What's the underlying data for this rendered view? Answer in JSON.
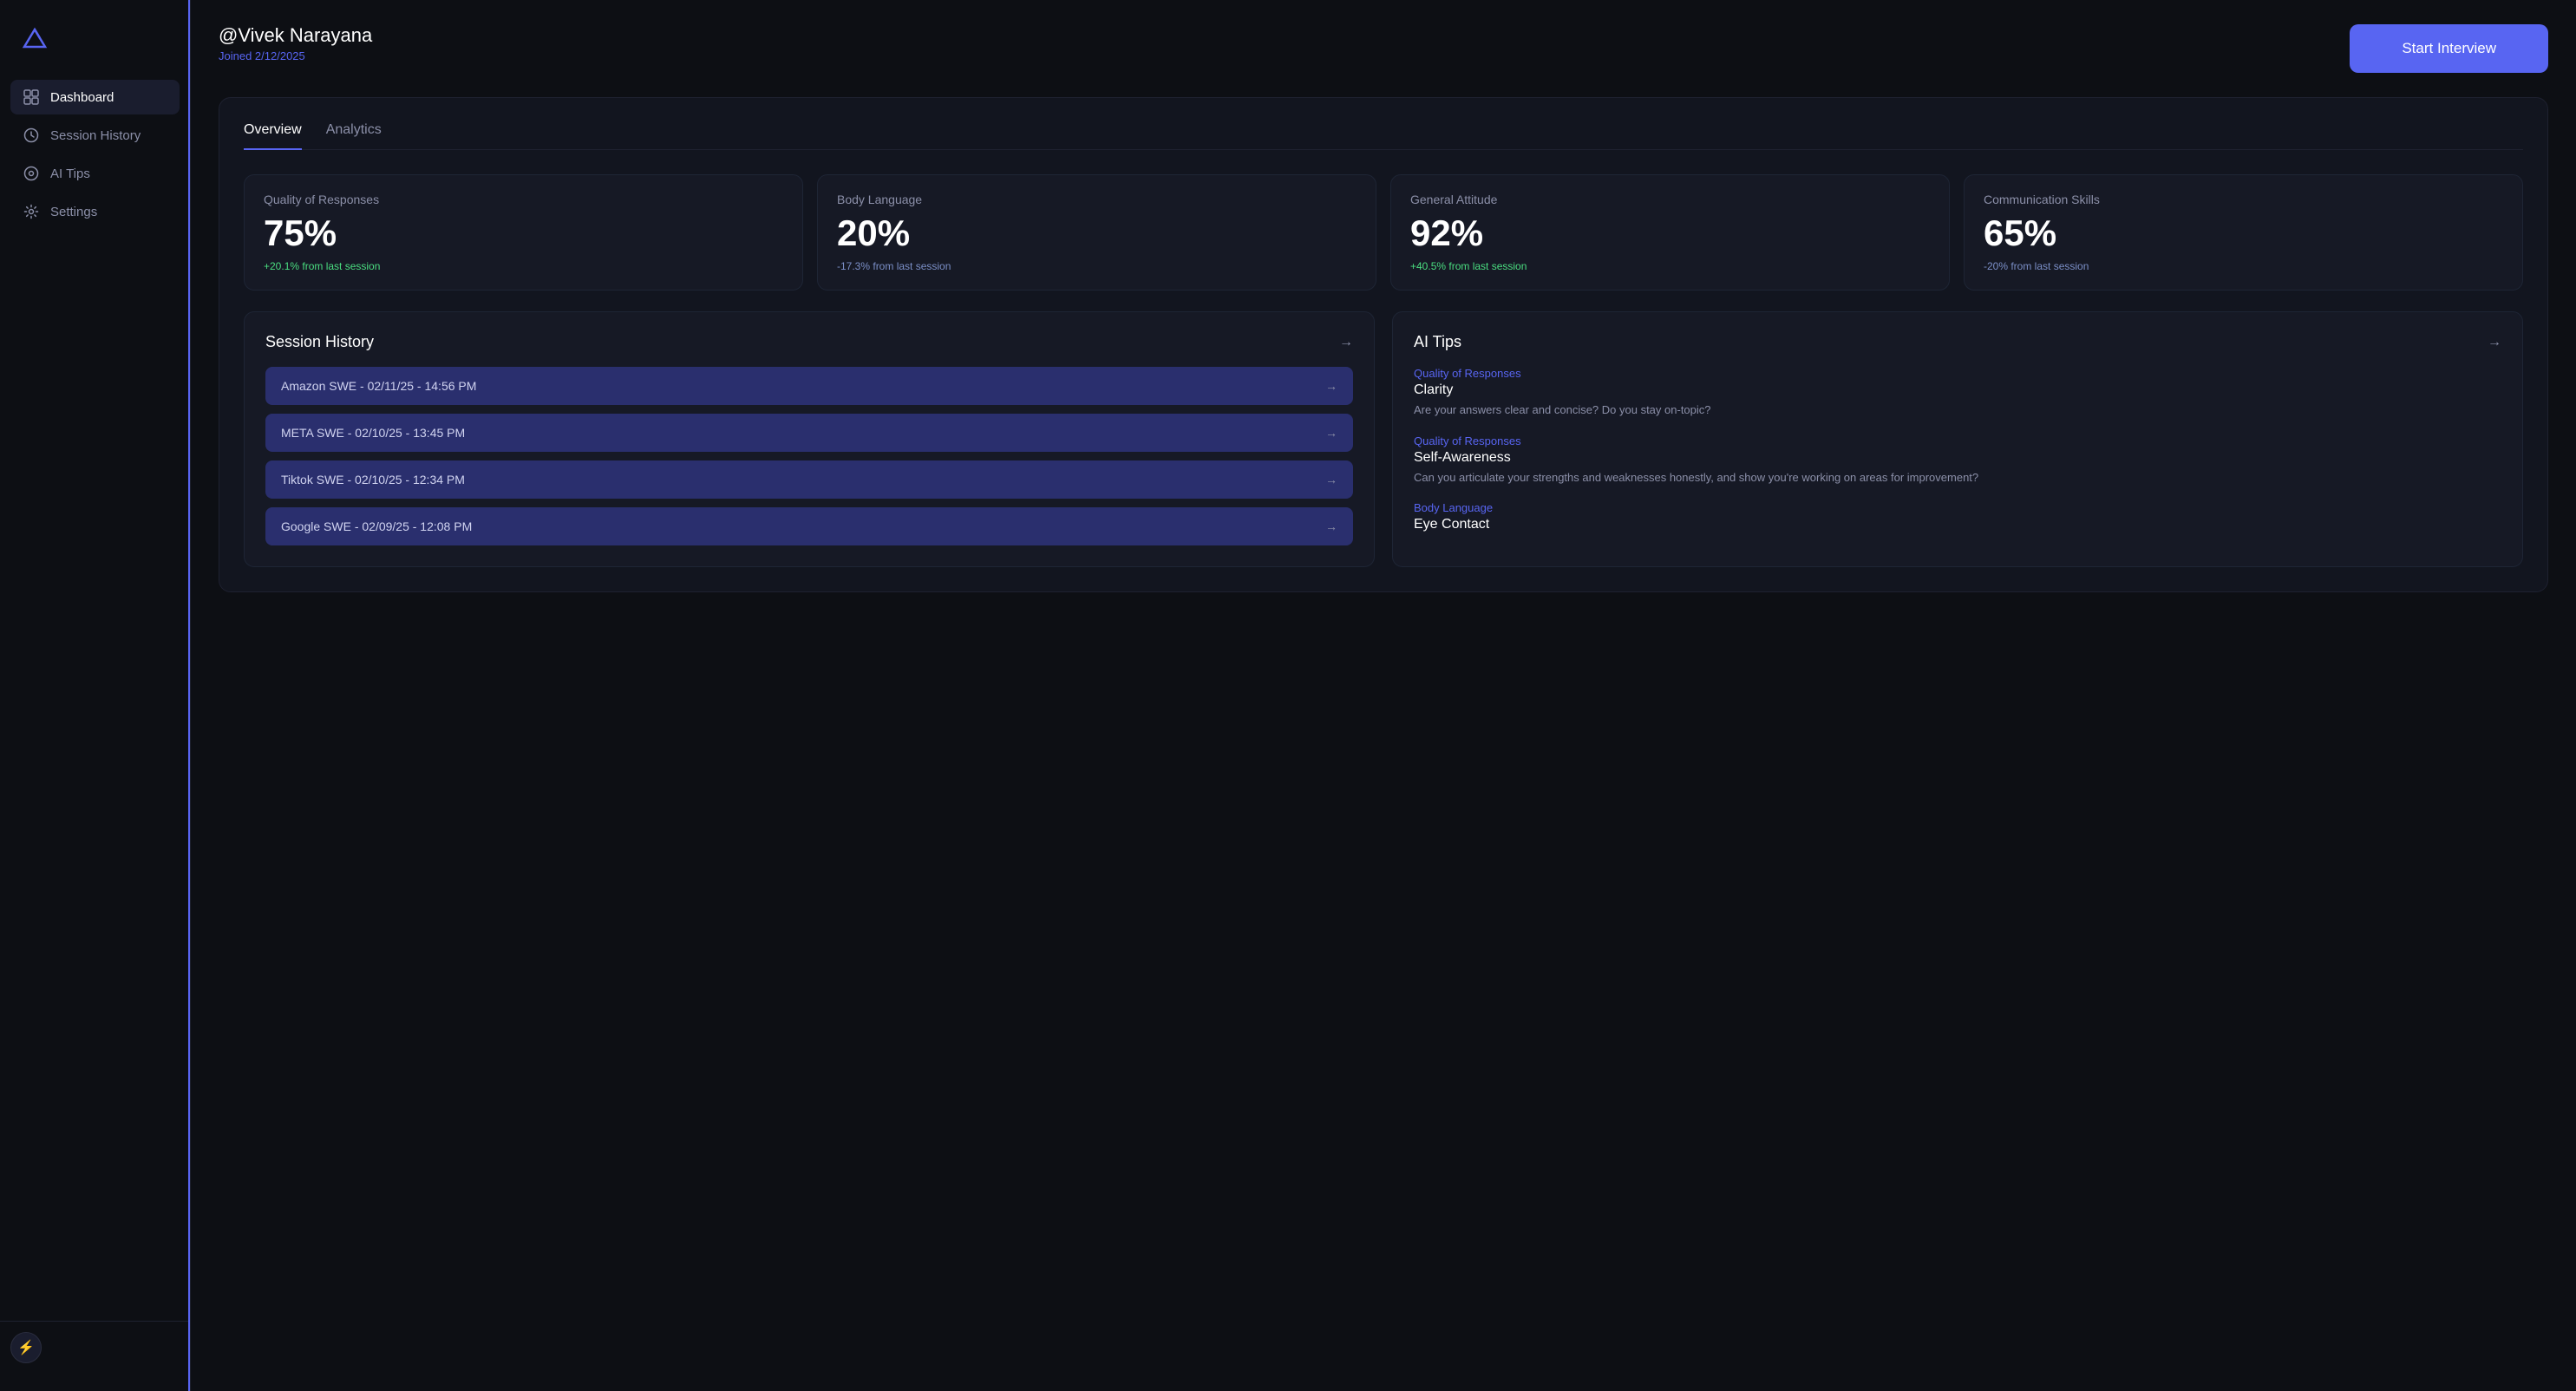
{
  "sidebar": {
    "logo_alt": "App Logo",
    "nav_items": [
      {
        "id": "dashboard",
        "label": "Dashboard",
        "active": true
      },
      {
        "id": "session-history",
        "label": "Session History",
        "active": false
      },
      {
        "id": "ai-tips",
        "label": "AI Tips",
        "active": false
      },
      {
        "id": "settings",
        "label": "Settings",
        "active": false
      }
    ],
    "bottom_icon": "⚡"
  },
  "header": {
    "username": "@Vivek Narayana",
    "joined": "Joined 2/12/2025",
    "start_interview_label": "Start Interview"
  },
  "tabs": [
    {
      "id": "overview",
      "label": "Overview",
      "active": true
    },
    {
      "id": "analytics",
      "label": "Analytics",
      "active": false
    }
  ],
  "metrics": [
    {
      "label": "Quality of Responses",
      "value": "75%",
      "change": "+20.1% from last session",
      "change_type": "positive"
    },
    {
      "label": "Body Language",
      "value": "20%",
      "change": "-17.3% from last session",
      "change_type": "negative"
    },
    {
      "label": "General Attitude",
      "value": "92%",
      "change": "+40.5% from last session",
      "change_type": "positive"
    },
    {
      "label": "Communication Skills",
      "value": "65%",
      "change": "-20% from last session",
      "change_type": "negative"
    }
  ],
  "session_history": {
    "title": "Session History",
    "arrow": "→",
    "items": [
      {
        "label": "Amazon SWE - 02/11/25 - 14:56 PM"
      },
      {
        "label": "META SWE - 02/10/25 - 13:45 PM"
      },
      {
        "label": "Tiktok SWE - 02/10/25 - 12:34 PM"
      },
      {
        "label": "Google SWE - 02/09/25 - 12:08 PM"
      }
    ]
  },
  "ai_tips": {
    "title": "AI Tips",
    "arrow": "→",
    "items": [
      {
        "category": "Quality of Responses",
        "title": "Clarity",
        "description": "Are your answers clear and concise? Do you stay on-topic?"
      },
      {
        "category": "Quality of Responses",
        "title": "Self-Awareness",
        "description": "Can you articulate your strengths and weaknesses honestly, and show you're working on areas for improvement?"
      },
      {
        "category": "Body Language",
        "title": "Eye Contact",
        "description": ""
      }
    ]
  }
}
